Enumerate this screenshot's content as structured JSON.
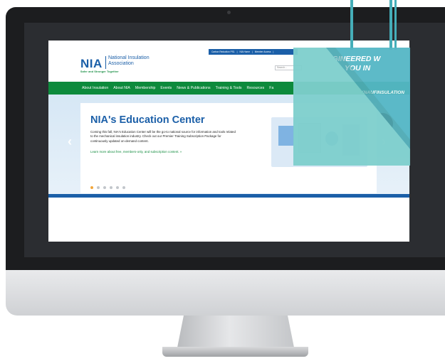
{
  "site": {
    "logo_short": "NIA",
    "logo_name": "National Insulation Association",
    "tagline": "Safer and Stronger Together",
    "search_placeholder": "Search...",
    "utility_links": [
      "Carbon Reduction PS1",
      "|",
      "NIA Home",
      "|",
      "Member Access",
      "|"
    ],
    "nav": [
      "About Insulation",
      "About NIA",
      "Membership",
      "Events",
      "News & Publications",
      "Training & Tools",
      "Resources",
      "Fa"
    ],
    "hero": {
      "title": "NIA's Education Center",
      "body": "Coming this fall, NIA's Education Center will be the go-to national source for information and tools related to the mechanical insulation industry. Check out our Premier Training Subscription Package for continuously updated on-demand content.",
      "link": "Learn more about free, members-only, and subscription content. »",
      "slides_total": 6,
      "slide_active": 1
    }
  },
  "ad": {
    "headline_line1": "ENGINEERED W",
    "headline_line2": "YOU IN",
    "brand": "KNAUFINSULATION"
  },
  "colors": {
    "brand_blue": "#1b5fa8",
    "nav_green": "#0d8a3c",
    "active_dot": "#f2a63a",
    "ad_teal": "#55b7c6"
  }
}
